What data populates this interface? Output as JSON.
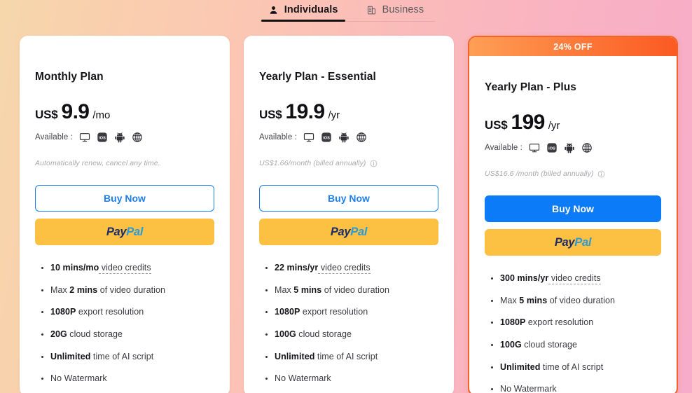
{
  "tabs": [
    {
      "label": "Individuals",
      "icon": "person-icon",
      "active": true
    },
    {
      "label": "Business",
      "icon": "building-icon",
      "active": false
    }
  ],
  "colors": {
    "accent_blue": "#0b7bf7",
    "paypal_yellow": "#fcc042",
    "ribbon_orange": "#fb5a22",
    "highlight_border": "#f2632a"
  },
  "common": {
    "available_label": "Available :",
    "buy_now_label": "Buy Now",
    "paypal_pay": "Pay",
    "paypal_pal": "Pal",
    "platforms": [
      "desktop-icon",
      "ios-icon",
      "android-icon",
      "web-icon"
    ]
  },
  "plans": [
    {
      "name": "Monthly Plan",
      "currency": "US$",
      "amount": "9.9",
      "period": "/mo",
      "note": "Automatically renew, cancel any time.",
      "note_has_info": false,
      "badge": null,
      "buy_style": "outline",
      "features": [
        {
          "strong": "10 mins/mo",
          "rest": " video credits",
          "rest_dashed": true,
          "lead": ""
        },
        {
          "strong": "2 mins",
          "rest": " of video duration",
          "rest_dashed": false,
          "lead": "Max "
        },
        {
          "strong": "1080P",
          "rest": " export resolution",
          "rest_dashed": false,
          "lead": ""
        },
        {
          "strong": "20G",
          "rest": " cloud storage",
          "rest_dashed": false,
          "lead": ""
        },
        {
          "strong": "Unlimited",
          "rest": " time of AI script",
          "rest_dashed": false,
          "lead": ""
        },
        {
          "strong": "",
          "rest": "No Watermark",
          "rest_dashed": false,
          "lead": ""
        }
      ]
    },
    {
      "name": "Yearly Plan - Essential",
      "currency": "US$",
      "amount": "19.9",
      "period": "/yr",
      "note": "US$1.66/month (billed annually)",
      "note_has_info": true,
      "badge": null,
      "buy_style": "outline",
      "features": [
        {
          "strong": "22 mins/yr",
          "rest": " video credits",
          "rest_dashed": true,
          "lead": ""
        },
        {
          "strong": "5 mins",
          "rest": " of video duration",
          "rest_dashed": false,
          "lead": "Max "
        },
        {
          "strong": "1080P",
          "rest": " export resolution",
          "rest_dashed": false,
          "lead": ""
        },
        {
          "strong": "100G",
          "rest": " cloud storage",
          "rest_dashed": false,
          "lead": ""
        },
        {
          "strong": "Unlimited",
          "rest": " time of AI script",
          "rest_dashed": false,
          "lead": ""
        },
        {
          "strong": "",
          "rest": "No Watermark",
          "rest_dashed": false,
          "lead": ""
        }
      ]
    },
    {
      "name": "Yearly Plan - Plus",
      "currency": "US$",
      "amount": "199",
      "period": "/yr",
      "note": "US$16.6 /month (billed annually)",
      "note_has_info": true,
      "badge": "24% OFF",
      "buy_style": "filled",
      "features": [
        {
          "strong": "300 mins/yr",
          "rest": " video credits",
          "rest_dashed": true,
          "lead": ""
        },
        {
          "strong": "5 mins",
          "rest": " of video duration",
          "rest_dashed": false,
          "lead": "Max "
        },
        {
          "strong": "1080P",
          "rest": " export resolution",
          "rest_dashed": false,
          "lead": ""
        },
        {
          "strong": "100G",
          "rest": " cloud storage",
          "rest_dashed": false,
          "lead": ""
        },
        {
          "strong": "Unlimited",
          "rest": " time of AI script",
          "rest_dashed": false,
          "lead": ""
        },
        {
          "strong": "",
          "rest": "No Watermark",
          "rest_dashed": false,
          "lead": ""
        }
      ]
    }
  ]
}
